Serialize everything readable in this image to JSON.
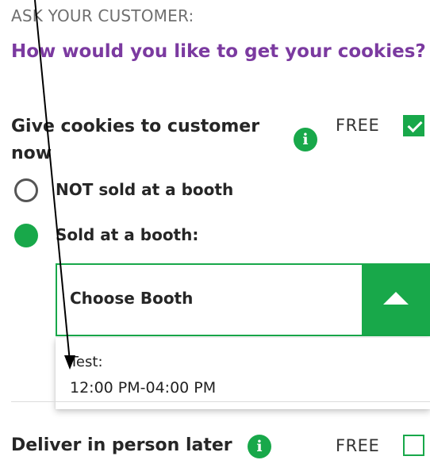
{
  "header": {
    "eyebrow": "ASK YOUR CUSTOMER:",
    "question": "How would you like to get your cookies?"
  },
  "options": {
    "give_now": {
      "label": "Give cookies to customer now",
      "price": "FREE",
      "checked": true
    },
    "deliver_later": {
      "label": "Deliver in person later",
      "price": "FREE",
      "checked": false
    }
  },
  "booth": {
    "not_sold_label": "NOT sold at a booth",
    "sold_label": "Sold at a booth:",
    "selected_option": "sold",
    "select_placeholder": "Choose Booth",
    "dropdown_items": [
      {
        "name": "Test:",
        "time": "12:00 PM-04:00 PM"
      }
    ]
  },
  "icons": {
    "info": "info-icon",
    "select_toggle": "chevron-up-icon",
    "pointer": "arrow-annotation"
  },
  "colors": {
    "brand_green": "#18a84a",
    "question_purple": "#7b3aa0",
    "muted_gray": "#6f6f6f"
  }
}
